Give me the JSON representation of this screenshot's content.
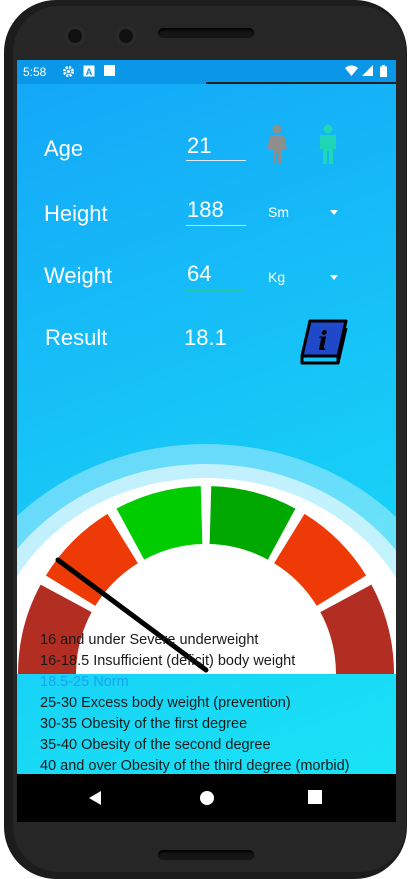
{
  "status": {
    "time": "5:58",
    "icons": [
      "settings-icon",
      "a-icon",
      "square-icon",
      "wifi-icon",
      "signal-icon",
      "battery-icon"
    ]
  },
  "form": {
    "age": {
      "label": "Age",
      "value": "21"
    },
    "height": {
      "label": "Height",
      "value": "188",
      "unit": "Sm"
    },
    "weight": {
      "label": "Weight",
      "value": "64",
      "unit": "Kg"
    },
    "result": {
      "label": "Result",
      "value": "18.1"
    }
  },
  "gender": {
    "selected": "male",
    "colors": {
      "female": "#8e8e8e",
      "male": "#1ed7b6"
    }
  },
  "gauge": {
    "value": 18.1,
    "segment_colors": [
      "#b22d22",
      "#ee3a07",
      "#00cc00",
      "#00a800",
      "#ee3a07",
      "#b22d22"
    ]
  },
  "legend": {
    "items": [
      {
        "text": "16 and under Severe underweight",
        "color": "#1a1a1a"
      },
      {
        "text": "16-18.5 Insufficient (deficit) body weight",
        "color": "#1a1a1a"
      },
      {
        "text": "18.5-25 Norm",
        "color": "#1aa3f0"
      },
      {
        "text": "25-30 Excess body weight (prevention)",
        "color": "#1a1a1a"
      },
      {
        "text": "30-35 Obesity of the first degree",
        "color": "#1a1a1a"
      },
      {
        "text": "35-40 Obesity of the second degree",
        "color": "#1a1a1a"
      },
      {
        "text": "40 and over Obesity of the third degree (morbid)",
        "color": "#1a1a1a"
      }
    ]
  },
  "nav": {
    "icons": [
      "back-icon",
      "home-icon",
      "recents-icon"
    ]
  }
}
